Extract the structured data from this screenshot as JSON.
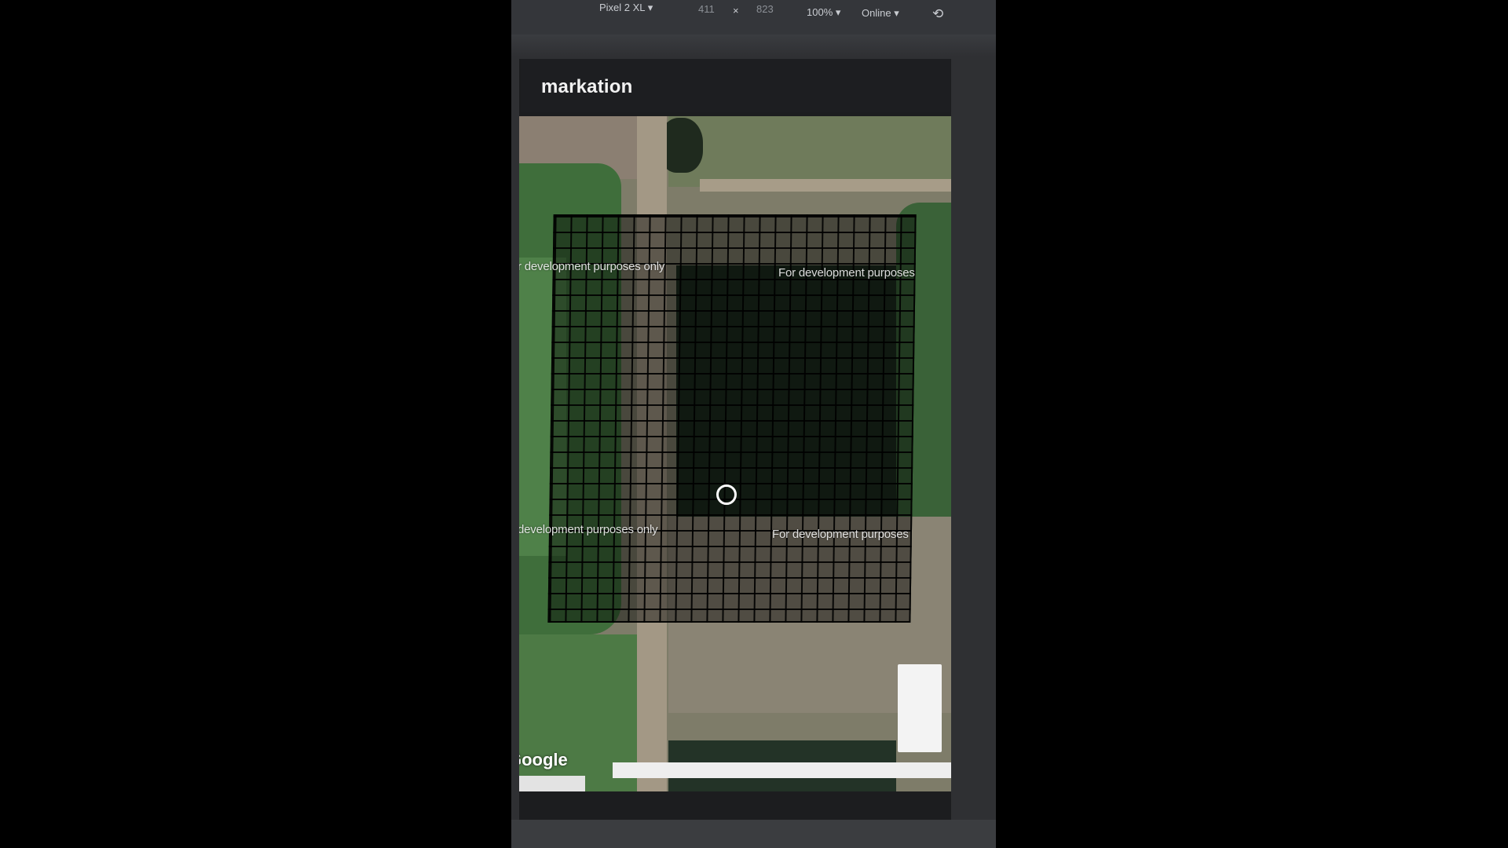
{
  "devtools_toolbar": {
    "device_label": "Pixel 2 XL",
    "width_value": "411",
    "times_symbol": "×",
    "height_value": "823",
    "zoom_label": "100%",
    "network_label": "Online",
    "dropdown_glyph": "▾",
    "rotate_glyph": "⟲"
  },
  "app": {
    "title": "markation"
  },
  "map": {
    "watermark_top_left": "r development purposes only",
    "watermark_top_right": "For development purposes",
    "watermark_bottom_left": "development purposes only",
    "watermark_bottom_right": "For development purposes",
    "google_logo": "Google"
  },
  "colors": {
    "page_background": "#000000",
    "devtools_background": "#2f3033",
    "app_header": "#1d1e21",
    "vegetation": "#3e6b3a",
    "field": "#6f7a5a",
    "dirt_path": "#a59a86",
    "grid_lines": "#000000",
    "marker": "#ffffff"
  },
  "icons": {
    "location_marker": "circle-outline-icon",
    "rotate": "rotate-icon",
    "dropdown": "chevron-down-icon"
  }
}
